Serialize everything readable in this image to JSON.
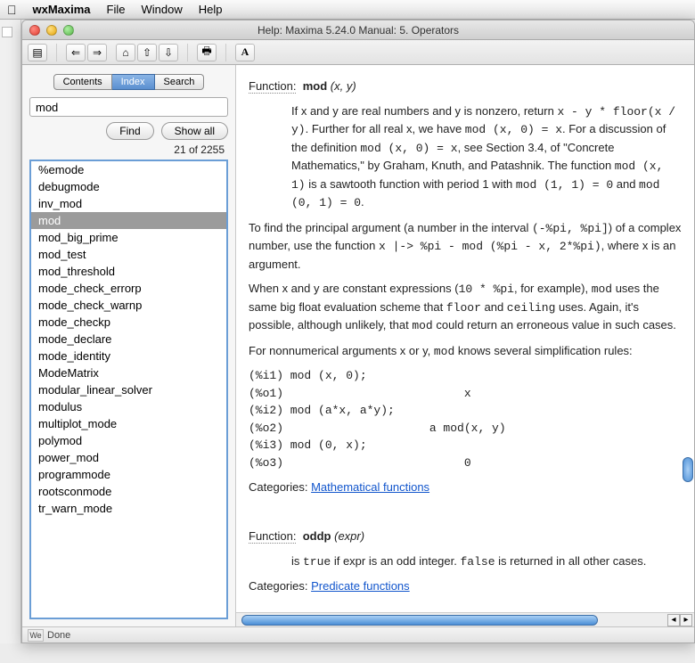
{
  "menubar": {
    "app_name": "wxMaxima",
    "items": [
      "File",
      "Window",
      "Help"
    ]
  },
  "window": {
    "title": "Help: Maxima 5.24.0 Manual: 5. Operators"
  },
  "toolbar": {
    "sidebar_toggle": "sidebar",
    "back": "←",
    "forward": "→",
    "home": "⌂",
    "up": "↑",
    "down": "↓",
    "print": "⎙",
    "font": "A"
  },
  "sidebar": {
    "tabs": {
      "contents": "Contents",
      "index": "Index",
      "search": "Search"
    },
    "search_value": "mod",
    "find_label": "Find",
    "showall_label": "Show all",
    "result_count": "21 of 2255",
    "items": [
      "%emode",
      "debugmode",
      "inv_mod",
      "mod",
      "mod_big_prime",
      "mod_test",
      "mod_threshold",
      "mode_check_errorp",
      "mode_check_warnp",
      "mode_checkp",
      "mode_declare",
      "mode_identity",
      "ModeMatrix",
      "modular_linear_solver",
      "modulus",
      "multiplot_mode",
      "polymod",
      "power_mod",
      "programmode",
      "rootsconmode",
      "tr_warn_mode"
    ],
    "selected_index": 3
  },
  "content": {
    "fn1_label": "Function:",
    "fn1_name": "mod",
    "fn1_sig": "(x, y)",
    "para1_a": "If x and y are real numbers and y is nonzero, return ",
    "para1_code1": "x - y * floor(x / y)",
    "para1_b": ". Further for all real x, we have ",
    "para1_code2": "mod (x, 0) = x",
    "para1_c": ". For a discussion of the definition ",
    "para1_code3": "mod (x, 0) = x",
    "para1_d": ", see Section 3.4, of \"Concrete Mathematics,\" by Graham, Knuth, and Patashnik. The function ",
    "para1_code4": "mod (x, 1)",
    "para1_e": " is a sawtooth function with period 1 with ",
    "para1_code5": "mod (1, 1) = 0",
    "para1_f": " and ",
    "para1_code6": "mod (0, 1) = 0",
    "para1_g": ".",
    "para2_a": "To find the principal argument (a number in the interval ",
    "para2_code1": "(-%pi, %pi]",
    "para2_b": ") of a complex number, use the function ",
    "para2_code2": "x |-> %pi - mod (%pi - x, 2*%pi)",
    "para2_c": ", where x is an argument.",
    "para3_a": "When x and y are constant expressions (",
    "para3_code1": "10 * %pi",
    "para3_b": ", for example), ",
    "para3_code2": "mod",
    "para3_c": " uses the same big float evaluation scheme that ",
    "para3_code3": "floor",
    "para3_d": " and ",
    "para3_code4": "ceiling",
    "para3_e": " uses. Again, it's possible, although unlikely, that ",
    "para3_code5": "mod",
    "para3_f": " could return an erroneous value in such cases.",
    "para4_a": "For nonnumerical arguments x or y, ",
    "para4_code1": "mod",
    "para4_b": " knows several simplification rules:",
    "codeblock": "(%i1) mod (x, 0);\n(%o1)                          x\n(%i2) mod (a*x, a*y);\n(%o2)                     a mod(x, y)\n(%i3) mod (0, x);\n(%o3)                          0",
    "cat1_label": "Categories:  ",
    "cat1_link": "Mathematical functions",
    "fn2_label": "Function:",
    "fn2_name": "oddp",
    "fn2_sig": "(expr)",
    "para5_a": "is ",
    "para5_code1": "true",
    "para5_b": " if expr is an odd integer. ",
    "para5_code2": "false",
    "para5_c": " is returned in all other cases.",
    "cat2_label": "Categories:  ",
    "cat2_link": "Predicate functions"
  },
  "statusbar": {
    "badge": "We",
    "text": "Done"
  }
}
